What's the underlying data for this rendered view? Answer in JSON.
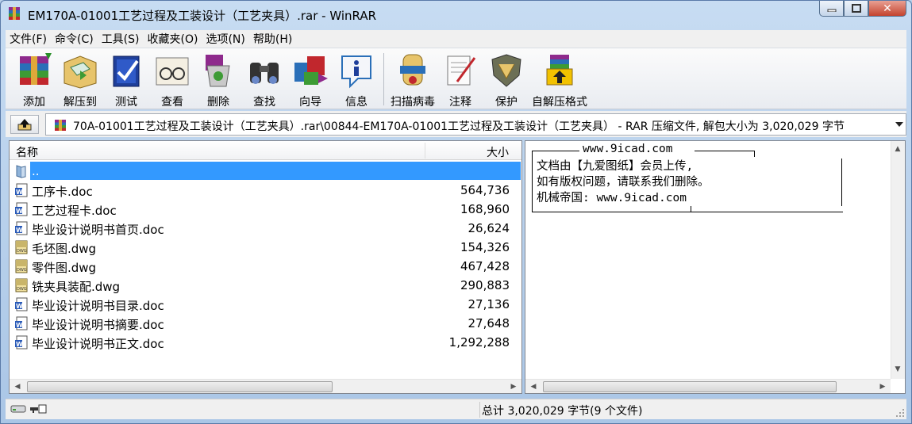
{
  "window": {
    "title": "EM170A-01001工艺过程及工装设计（工艺夹具）.rar - WinRAR",
    "icon": "winrar-icon",
    "controls": [
      "minimize",
      "maximize",
      "close"
    ]
  },
  "menu": [
    "文件(F)",
    "命令(C)",
    "工具(S)",
    "收藏夹(O)",
    "选项(N)",
    "帮助(H)"
  ],
  "toolbar": [
    {
      "label": "添加",
      "icon": "add-archive-icon"
    },
    {
      "label": "解压到",
      "icon": "extract-to-icon"
    },
    {
      "label": "测试",
      "icon": "test-icon"
    },
    {
      "label": "查看",
      "icon": "view-icon"
    },
    {
      "label": "删除",
      "icon": "delete-icon"
    },
    {
      "label": "查找",
      "icon": "find-icon"
    },
    {
      "label": "向导",
      "icon": "wizard-icon"
    },
    {
      "label": "信息",
      "icon": "info-icon"
    },
    {
      "label": "扫描病毒",
      "icon": "virus-scan-icon"
    },
    {
      "label": "注释",
      "icon": "comment-icon"
    },
    {
      "label": "保护",
      "icon": "protect-icon"
    },
    {
      "label": "自解压格式",
      "icon": "sfx-icon"
    }
  ],
  "address": {
    "path": "70A-01001工艺过程及工装设计（工艺夹具）.rar\\00844-EM170A-01001工艺过程及工装设计（工艺夹具） - RAR 压缩文件, 解包大小为 3,020,029 字节"
  },
  "filelist": {
    "columns": {
      "name": "名称",
      "size": "大小"
    },
    "rows": [
      {
        "name": "..",
        "size": "",
        "type": "folder",
        "selected": true
      },
      {
        "name": "工序卡.doc",
        "size": "564,736",
        "type": "doc"
      },
      {
        "name": "工艺过程卡.doc",
        "size": "168,960",
        "type": "doc"
      },
      {
        "name": "毕业设计说明书首页.doc",
        "size": "26,624",
        "type": "doc"
      },
      {
        "name": "毛坯图.dwg",
        "size": "154,326",
        "type": "dwg"
      },
      {
        "name": "零件图.dwg",
        "size": "467,428",
        "type": "dwg"
      },
      {
        "name": "铣夹具装配.dwg",
        "size": "290,883",
        "type": "dwg"
      },
      {
        "name": "毕业设计说明书目录.doc",
        "size": "27,136",
        "type": "doc"
      },
      {
        "name": "毕业设计说明书摘要.doc",
        "size": "27,648",
        "type": "doc"
      },
      {
        "name": "毕业设计说明书正文.doc",
        "size": "1,292,288",
        "type": "doc"
      }
    ]
  },
  "comment": {
    "header": "www.9icad.com",
    "lines": [
      "文档由【九爱图纸】会员上传,",
      "如有版权问题，请联系我们删除。",
      "机械帝国: www.9icad.com"
    ]
  },
  "status": {
    "summary": "总计 3,020,029 字节(9 个文件)"
  },
  "colors": {
    "selection": "#3399ff",
    "window_frame": "#aac6e6"
  }
}
